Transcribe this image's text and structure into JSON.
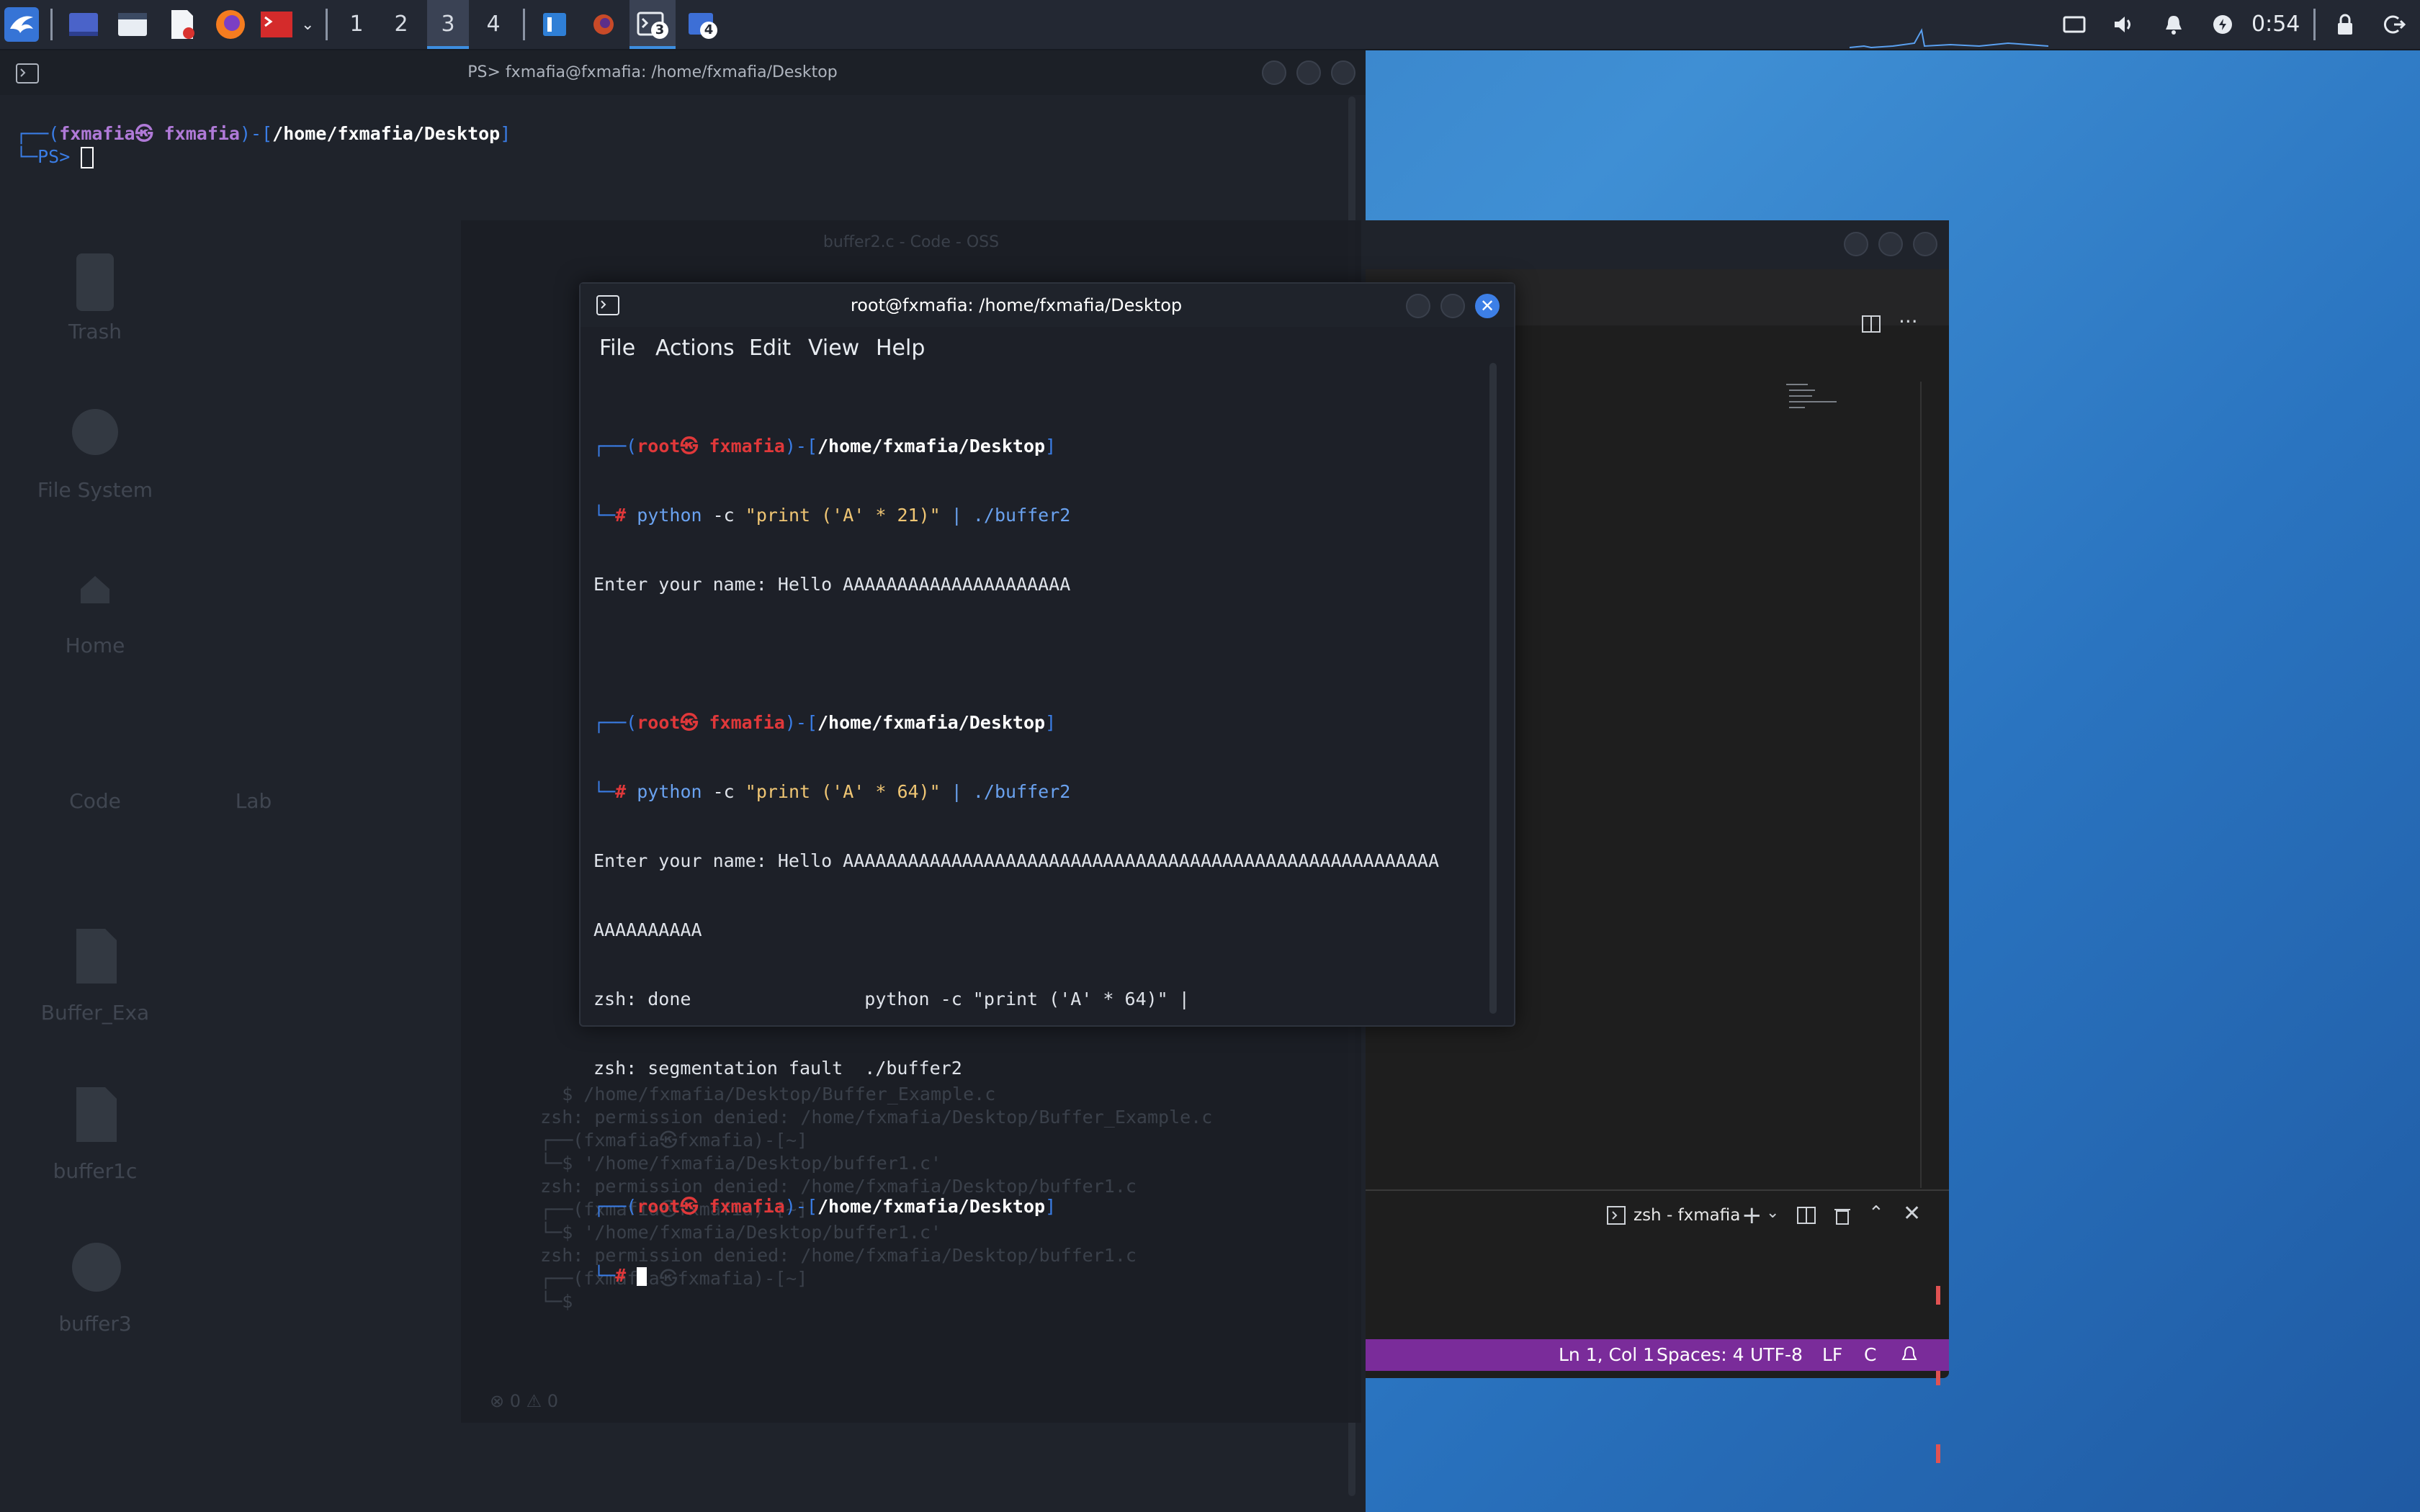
{
  "taskbar": {
    "workspaces": [
      "1",
      "2",
      "3",
      "4"
    ],
    "active_workspace": "3",
    "window_badges": [
      "3",
      "4"
    ],
    "clock": "0:54",
    "icons": [
      "kali-menu-icon",
      "show-desktop-icon",
      "file-manager-icon",
      "text-editor-icon",
      "firefox-icon",
      "terminal-emulator-icon",
      "dropdown-chevron-icon",
      "vscode-icon",
      "firefox-task-icon",
      "terminal-task-icon",
      "terminal-task-icon-2",
      "display-icon",
      "volume-icon",
      "notification-bell-icon",
      "power-status-icon",
      "lock-icon",
      "logout-icon"
    ]
  },
  "desktop": {
    "icon_labels": [
      "Trash",
      "File System",
      "Home",
      "Code",
      "Lab",
      "Buffer_Exa",
      "buffer1c",
      "buffer3"
    ]
  },
  "bg_terminal": {
    "title": "PS> fxmafia@fxmafia: /home/fxmafia/Desktop",
    "prompt_open": "┌──(",
    "user": "fxmafia㉿ fxmafia",
    "prompt_mid": ")-[",
    "path": "/home/fxmafia/Desktop",
    "prompt_close": "]",
    "ps_prefix": "└─",
    "ps": "PS>"
  },
  "vscode": {
    "title": "buffer2.c - Code - OSS",
    "terminal_tab": "zsh - fxmafia",
    "status": {
      "position": "Ln 1, Col 1",
      "spaces": "Spaces: 4",
      "encoding": "UTF-8",
      "eol": "LF",
      "language": "C"
    },
    "ghost_lines": [
      "    $ /home/fxmafia/Desktop/Buffer_Example.c",
      "  zsh: permission denied: /home/fxmafia/Desktop/Buffer_Example.c",
      "",
      "  ┌──(fxmafia㉿fxmafia)-[~]",
      "  └─$ '/home/fxmafia/Desktop/buffer1.c'",
      "  zsh: permission denied: /home/fxmafia/Desktop/buffer1.c",
      "",
      "  ┌──(fxmafia㉿fxmafia)-[~]",
      "  └─$ '/home/fxmafia/Desktop/buffer1.c'",
      "  zsh: permission denied: /home/fxmafia/Desktop/buffer1.c",
      "",
      "  ┌──(fxmafia㉿fxmafia)-[~]",
      "  └─$"
    ],
    "ghost_status": "⊗ 0 ⚠ 0"
  },
  "root_terminal": {
    "title": "root@fxmafia: /home/fxmafia/Desktop",
    "menu": [
      "File",
      "Actions",
      "Edit",
      "View",
      "Help"
    ],
    "prompt": {
      "open": "┌──(",
      "user": "root㉿ fxmafia",
      "mid": ")-[",
      "path": "/home/fxmafia/Desktop",
      "close": "]",
      "hash_prefix": "└─",
      "hash": "#"
    },
    "commands": [
      {
        "cmd": "python",
        "args": " -c ",
        "str": "\"print ('A' * 21)\"",
        "pipe": " | ",
        "target": "./buffer2"
      },
      {
        "cmd": "python",
        "args": " -c ",
        "str": "\"print ('A' * 64)\"",
        "pipe": " | ",
        "target": "./buffer2"
      }
    ],
    "output1": "Enter your name: Hello AAAAAAAAAAAAAAAAAAAAA",
    "output2_line1": "Enter your name: Hello AAAAAAAAAAAAAAAAAAAAAAAAAAAAAAAAAAAAAAAAAAAAAAAAAAAAAAA",
    "output2_line2": "AAAAAAAAAA",
    "done_line": "zsh: done                python -c \"print ('A' * 64)\" |",
    "segfault_line": "zsh: segmentation fault  ./buffer2"
  }
}
